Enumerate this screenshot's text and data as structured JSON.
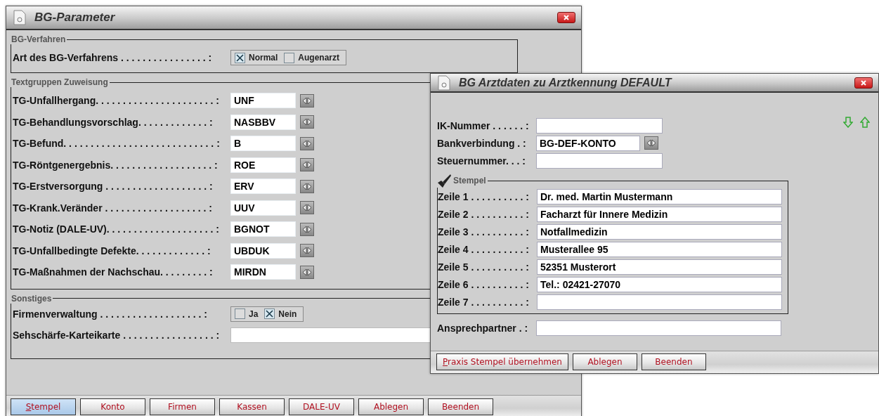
{
  "main_window": {
    "title": "BG-Parameter",
    "sections": [
      {
        "title": "BG-Verfahren",
        "rows": [
          {
            "kind": "options",
            "label": "Art des BG-Verfahrens . . . . . . . . . . . . . . . . :",
            "options": [
              {
                "label": "Normal",
                "checked": true
              },
              {
                "label": "Augenarzt",
                "checked": false
              }
            ]
          }
        ]
      },
      {
        "title": "Textgruppen Zuweisung",
        "rows": [
          {
            "kind": "lookup",
            "label": "TG-Unfallhergang. . . . . . . . . . . . . . . . . . . . . . :",
            "value": "UNF"
          },
          {
            "kind": "lookup",
            "label": "TG-Behandlungsvorschlag. . . . . . . . . . . . . :",
            "value": "NASBBV"
          },
          {
            "kind": "lookup",
            "label": "TG-Befund. . . . . . . . . . . . . . . . . . . . . . . . . . . . :",
            "value": "B"
          },
          {
            "kind": "lookup",
            "label": "TG-Röntgenergebnis. . . . . . . . . . . . . . . . . . . :",
            "value": "ROE"
          },
          {
            "kind": "lookup",
            "label": "TG-Erstversorgung . . . . . . . . . . . . . . . . . . . :",
            "value": "ERV"
          },
          {
            "kind": "lookup",
            "label": "TG-Krank.Veränder . . . . . . . . . . . . . . . . . . . :",
            "value": "UUV"
          },
          {
            "kind": "lookup",
            "label": "TG-Notiz (DALE-UV). . . . . . . . . . . . . . . . . . . . :",
            "value": "BGNOT"
          },
          {
            "kind": "lookup",
            "label": "TG-Unfallbedingte Defekte. . . . . . . . . . . . . :",
            "value": "UBDUK"
          },
          {
            "kind": "lookup",
            "label": "TG-Maßnahmen der Nachschau. . . . . . . . . :",
            "value": "MIRDN"
          }
        ]
      },
      {
        "title": "Sonstiges",
        "rows": [
          {
            "kind": "options",
            "label": "Firmenverwaltung . . . . . . . . . . . . . . . . . . . :",
            "options": [
              {
                "label": "Ja",
                "checked": false
              },
              {
                "label": "Nein",
                "checked": true
              }
            ]
          },
          {
            "kind": "text",
            "label": "Sehschärfe-Karteikarte . . . . . . . . . . . . . . . . . :"
          }
        ]
      }
    ],
    "buttons": [
      {
        "label": "Stempel",
        "selected": true,
        "mnemonic": true
      },
      {
        "label": "Konto",
        "selected": false,
        "mnemonic": false
      },
      {
        "label": "Firmen",
        "selected": false,
        "mnemonic": false
      },
      {
        "label": "Kassen",
        "selected": false,
        "mnemonic": false
      },
      {
        "label": "DALE-UV",
        "selected": false,
        "mnemonic": false
      },
      {
        "label": "Ablegen",
        "selected": false,
        "mnemonic": false
      },
      {
        "label": "Beenden",
        "selected": false,
        "mnemonic": false
      }
    ]
  },
  "dialog": {
    "title": "BG Arztdaten zu Arztkennung DEFAULT",
    "fields": [
      {
        "kind": "text",
        "label": "IK-Nummer . . . . . . :"
      },
      {
        "kind": "lookup",
        "label": "Bankverbindung . :",
        "value": "BG-DEF-KONTO"
      },
      {
        "kind": "text",
        "label": "Steuernummer. . . :"
      }
    ],
    "stamp": {
      "title": "Stempel",
      "lines": [
        {
          "label": "Zeile 1 . . . . . . . . . . :",
          "value": "Dr. med. Martin Mustermann"
        },
        {
          "label": "Zeile 2 . . . . . . . . . . :",
          "value": "Facharzt für Innere Medizin"
        },
        {
          "label": "Zeile 3 . . . . . . . . . . :",
          "value": "Notfallmedizin"
        },
        {
          "label": "Zeile 4 . . . . . . . . . . :",
          "value": "Musterallee 95"
        },
        {
          "label": "Zeile 5 . . . . . . . . . . :",
          "value": "52351 Musterort"
        },
        {
          "label": "Zeile 6 . . . . . . . . . . :",
          "value": "Tel.: 02421-27070"
        },
        {
          "label": "Zeile 7 . . . . . . . . . . :"
        }
      ]
    },
    "contact": {
      "label": "Ansprechpartner . :"
    },
    "buttons": [
      {
        "label": "Praxis Stempel übernehmen",
        "selected": false,
        "mnemonic": true
      },
      {
        "label": "Ablegen",
        "selected": false,
        "mnemonic": false
      },
      {
        "label": "Beenden",
        "selected": false,
        "mnemonic": false
      }
    ]
  }
}
